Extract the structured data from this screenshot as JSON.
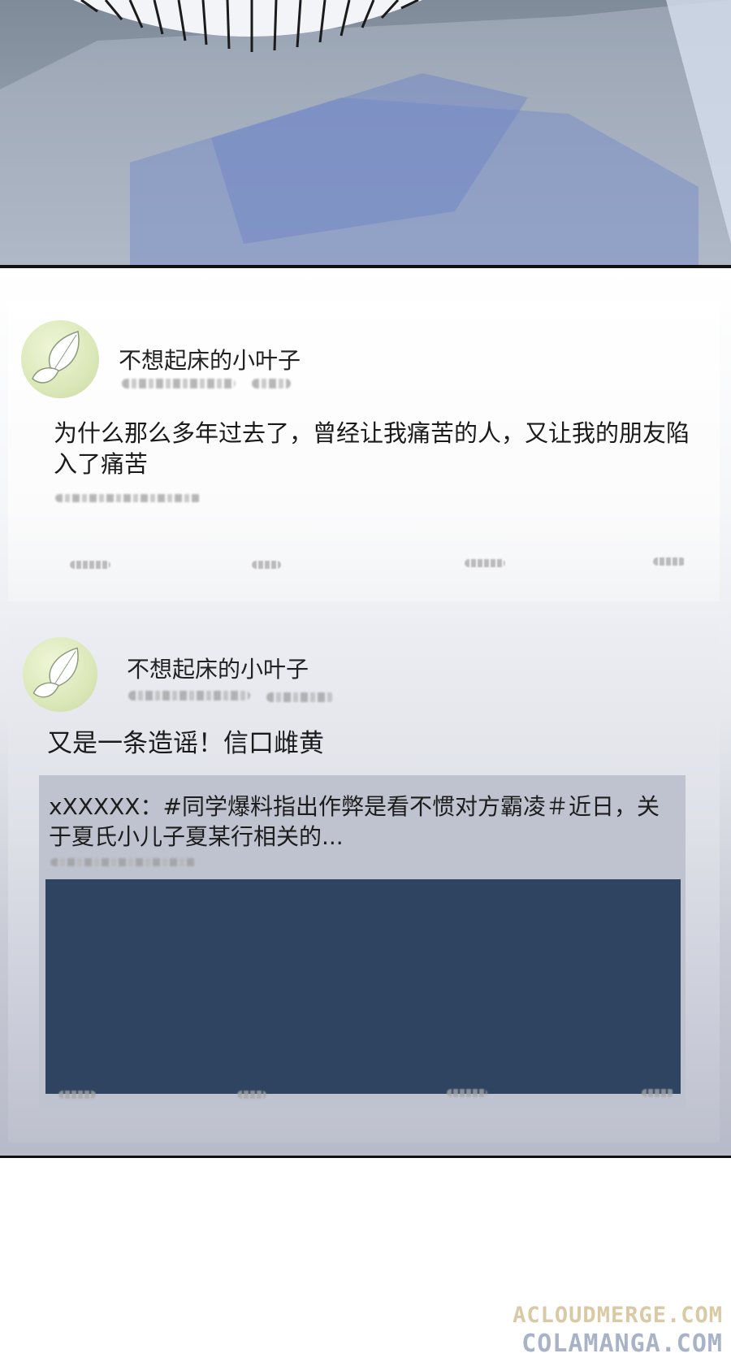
{
  "posts": [
    {
      "username": "不想起床的小叶子",
      "text": "为什么那么多年过去了，曾经让我痛苦的人，又让我的朋友陷入了痛苦"
    },
    {
      "username": "不想起床的小叶子",
      "text": "又是一条造谣！信口雌黄",
      "repost_text": "xXXXXX：#同学爆料指出作弊是看不惯对方霸凌＃近日，关于夏氏小儿子夏某行相关的..."
    }
  ],
  "watermark": {
    "line1": "ACLOUDMERGE.COM",
    "line2": "COLAMANGA.COM"
  }
}
